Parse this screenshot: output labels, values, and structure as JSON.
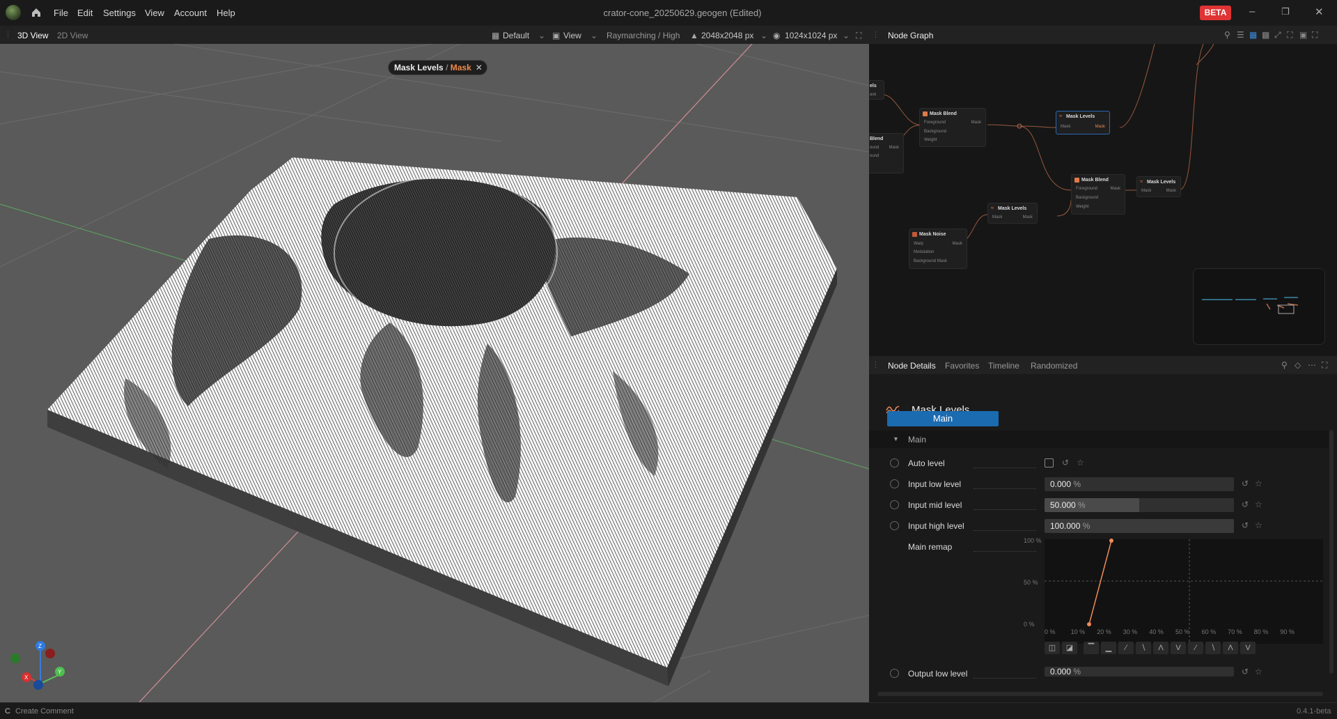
{
  "window": {
    "title": "crator-cone_20250629.geogen",
    "title_suffix": "(Edited)",
    "beta": "BETA"
  },
  "menu": [
    "File",
    "Edit",
    "Settings",
    "View",
    "Account",
    "Help"
  ],
  "viewport_toolbar": {
    "tabs": [
      "3D View",
      "2D View"
    ],
    "layout": "Default",
    "view": "View",
    "render": "Raymarching / High",
    "resolution": "2048x2048 px",
    "output_size": "1024x1024 px"
  },
  "viewport": {
    "badge_node": "Mask Levels",
    "badge_sep": "/",
    "badge_port": "Mask",
    "axes": {
      "x": "X",
      "y": "Y",
      "z": "Z"
    }
  },
  "node_graph": {
    "title": "Node Graph",
    "nodes": [
      {
        "title": "Mask Blend",
        "inputs": [
          "Foreground",
          "Background",
          "Weight"
        ],
        "output": "Mask"
      },
      {
        "title": "Mask Levels",
        "inputs": [
          "Mask"
        ],
        "output": "Mask"
      },
      {
        "title": "Mask Blend",
        "inputs": [
          "Foreground",
          "Background",
          "Weight"
        ],
        "output": "Mask"
      },
      {
        "title": "Mask Levels",
        "inputs": [
          "Mask"
        ],
        "output": "Mask"
      },
      {
        "title": "Mask Levels",
        "inputs": [
          "Mask"
        ],
        "output": "Mask"
      },
      {
        "title": "Mask Noise",
        "inputs": [
          "Warp",
          "Modulation",
          "Background Mask"
        ],
        "output": "Mask"
      }
    ],
    "partial_nodes": [
      {
        "title": "els",
        "row": "ask"
      },
      {
        "title": "Blend",
        "rows": [
          "ound",
          "ound"
        ],
        "output": "Mask"
      }
    ]
  },
  "node_details": {
    "tabs": [
      "Node Details",
      "Favorites",
      "Timeline",
      "Randomized"
    ],
    "node_title": "Mask Levels",
    "main_tab": "Main",
    "section": "Main",
    "params": {
      "auto_level": "Auto level",
      "input_low": {
        "label": "Input low level",
        "value": "0.000",
        "unit": "%",
        "fraction": 0.0
      },
      "input_mid": {
        "label": "Input mid level",
        "value": "50.000",
        "unit": "%",
        "fraction": 0.5
      },
      "input_high": {
        "label": "Input high level",
        "value": "100.000",
        "unit": "%",
        "fraction": 1.0
      },
      "main_remap": "Main remap",
      "output_low": {
        "label": "Output low level",
        "value": "0.000",
        "unit": "%"
      }
    },
    "remap": {
      "y_ticks": [
        "100 %",
        "50 %",
        "0 %"
      ],
      "x_ticks": [
        "0 %",
        "10 %",
        "20 %",
        "30 %",
        "40 %",
        "50 %",
        "60 %",
        "70 %",
        "80 %",
        "90 %"
      ],
      "curve_points": [
        [
          16.5,
          0
        ],
        [
          25,
          100
        ]
      ],
      "curve_color": "#f08a5a"
    }
  },
  "status": {
    "shortcut": "C",
    "comment": "Create Comment",
    "version": "0.4.1-beta"
  },
  "colors": {
    "accent": "#1b6bb0",
    "beta": "#e03434",
    "node_port": "#e07a4a"
  }
}
